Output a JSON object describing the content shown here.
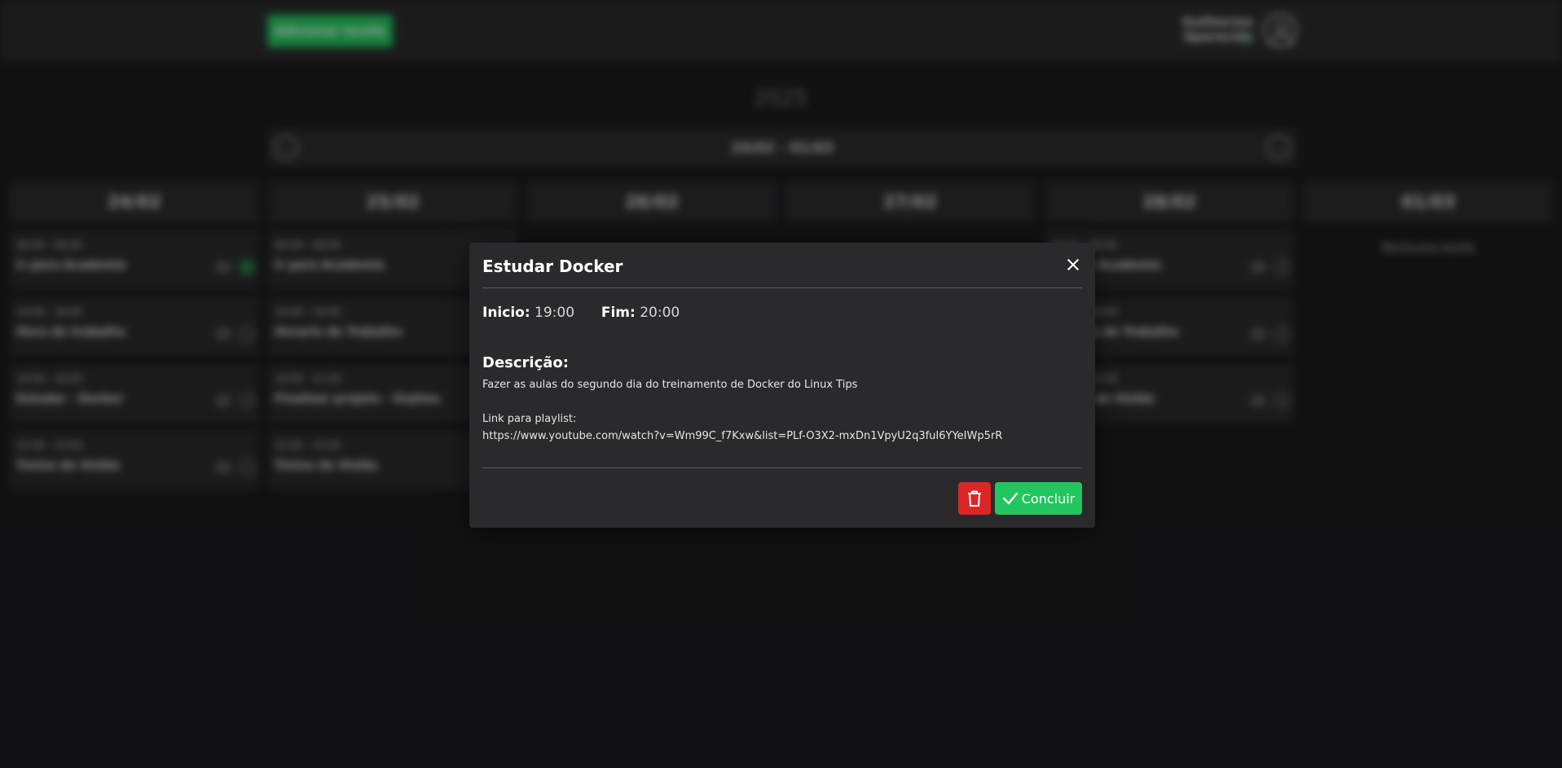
{
  "header": {
    "add_task_label": "Adicionar tarefa",
    "user_name": "Guilherme Aparecido",
    "user_status": "on"
  },
  "calendar": {
    "year": "2025",
    "week_range": "24/02 - 01/03",
    "days": [
      {
        "date": "24/02",
        "tasks": [
          {
            "time": "06:00 - 08:00",
            "title": "Ir para Academia",
            "done": true
          },
          {
            "time": "10:00 - 18:00",
            "title": "Hora de trabalho",
            "done": false
          },
          {
            "time": "19:00 - 20:00",
            "title": "Estudar - Docker",
            "done": false
          },
          {
            "time": "22:00 - 23:00",
            "title": "Treino de Violão",
            "done": false
          }
        ]
      },
      {
        "date": "25/02",
        "tasks": [
          {
            "time": "06:00 - 08:00",
            "title": "Ir para Academia",
            "done": false
          },
          {
            "time": "10:00 - 18:00",
            "title": "Horario de Trabalho",
            "done": false
          },
          {
            "time": "19:00 - 21:00",
            "title": "Finalizar projeto - Orpheu",
            "done": false
          },
          {
            "time": "22:00 - 23:00",
            "title": "Treino de Violão",
            "done": false
          }
        ]
      },
      {
        "date": "26/02",
        "tasks": []
      },
      {
        "date": "27/02",
        "tasks": []
      },
      {
        "date": "28/02",
        "tasks": [
          {
            "time": "06:00 - 08:00",
            "title": "Ir para Academia",
            "done": false
          },
          {
            "time": "10:00 - 18:00",
            "title": "Horario de Trabalho",
            "done": false
          },
          {
            "time": "22:00 - 23:00",
            "title": "Treino de Violão",
            "done": false
          }
        ]
      },
      {
        "date": "01/03",
        "tasks": [],
        "empty_label": "Nenhuma tarefa"
      }
    ]
  },
  "modal": {
    "title": "Estudar Docker",
    "start_label": "Inicio:",
    "start_value": "19:00",
    "end_label": "Fim:",
    "end_value": "20:00",
    "description_heading": "Descrição:",
    "description_text": "Fazer as aulas do segundo dia do treinamento de Docker do Linux Tips\n\nLink para playlist:\nhttps://www.youtube.com/watch?v=Wm99C_f7Kxw&list=PLf-O3X2-mxDn1VpyU2q3fuI6YYeIWp5rR",
    "complete_label": "Concluir"
  },
  "colors": {
    "accent_green": "#22c55e",
    "danger_red": "#dc2626",
    "background": "#1c1c1e",
    "panel": "#2a2a2c"
  }
}
